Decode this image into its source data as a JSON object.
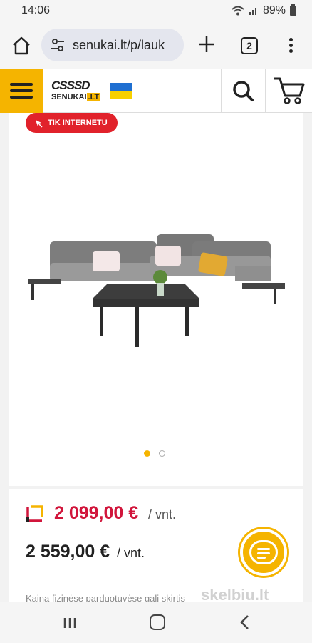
{
  "status_bar": {
    "time": "14:06",
    "battery": "89%"
  },
  "browser": {
    "url": "senukai.lt/p/lauk",
    "tab_count": "2"
  },
  "site": {
    "logo_top": "CSSSD",
    "logo_bottom": "SENUKAI",
    "logo_tld": ".LT"
  },
  "product": {
    "badge": "TIK INTERNETU",
    "image_count": 2,
    "active_image": 1,
    "price_club": "2 099,00 €",
    "price_club_unit": "/ vnt.",
    "price_regular": "2 559,00 €",
    "price_regular_unit": "/ vnt.",
    "note": "Kaina fizinėse parduotuvėse gali skirtis"
  },
  "watermark": "skelbiu.lt",
  "colors": {
    "brand_yellow": "#f5b400",
    "sale_red": "#d1153b",
    "badge_red": "#e1222b"
  }
}
